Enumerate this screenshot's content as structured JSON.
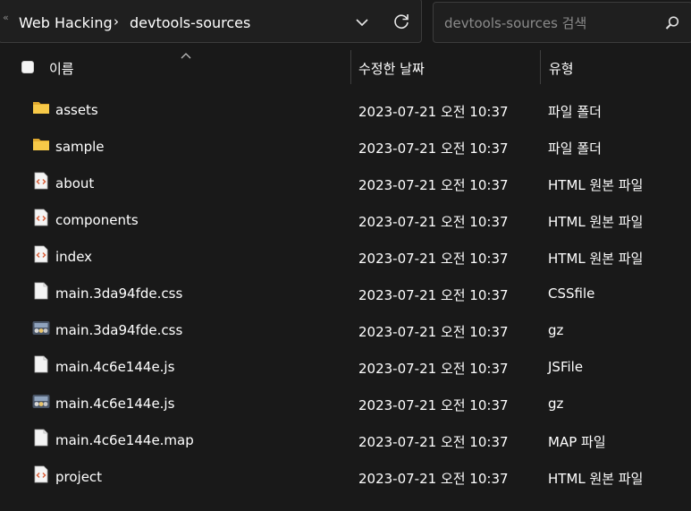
{
  "address_bar": {
    "overflow": "«",
    "breadcrumbs": [
      {
        "label": "Web Hacking"
      },
      {
        "label": "devtools-sources"
      }
    ],
    "separator": "›"
  },
  "search": {
    "placeholder": "devtools-sources 검색"
  },
  "columns": {
    "name": "이름",
    "modified": "수정한 날짜",
    "type": "유형"
  },
  "files": [
    {
      "icon": "folder-icon",
      "name": "assets",
      "modified": "2023-07-21 오전 10:37",
      "type": "파일 폴더"
    },
    {
      "icon": "folder-icon",
      "name": "sample",
      "modified": "2023-07-21 오전 10:37",
      "type": "파일 폴더"
    },
    {
      "icon": "html-file-icon",
      "name": "about",
      "modified": "2023-07-21 오전 10:37",
      "type": "HTML 원본 파일"
    },
    {
      "icon": "html-file-icon",
      "name": "components",
      "modified": "2023-07-21 오전 10:37",
      "type": "HTML 원본 파일"
    },
    {
      "icon": "html-file-icon",
      "name": "index",
      "modified": "2023-07-21 오전 10:37",
      "type": "HTML 원본 파일"
    },
    {
      "icon": "blank-file-icon",
      "name": "main.3da94fde.css",
      "modified": "2023-07-21 오전 10:37",
      "type": "CSSfile"
    },
    {
      "icon": "archive-file-icon",
      "name": "main.3da94fde.css",
      "modified": "2023-07-21 오전 10:37",
      "type": "gz"
    },
    {
      "icon": "blank-file-icon",
      "name": "main.4c6e144e.js",
      "modified": "2023-07-21 오전 10:37",
      "type": "JSFile"
    },
    {
      "icon": "archive-file-icon",
      "name": "main.4c6e144e.js",
      "modified": "2023-07-21 오전 10:37",
      "type": "gz"
    },
    {
      "icon": "blank-file-icon",
      "name": "main.4c6e144e.map",
      "modified": "2023-07-21 오전 10:37",
      "type": "MAP 파일"
    },
    {
      "icon": "html-file-icon",
      "name": "project",
      "modified": "2023-07-21 오전 10:37",
      "type": "HTML 원본 파일"
    }
  ],
  "colors": {
    "background": "#191919",
    "text": "#ffffff",
    "folder": "#f4c24c",
    "html_accent": "#d9603b"
  }
}
